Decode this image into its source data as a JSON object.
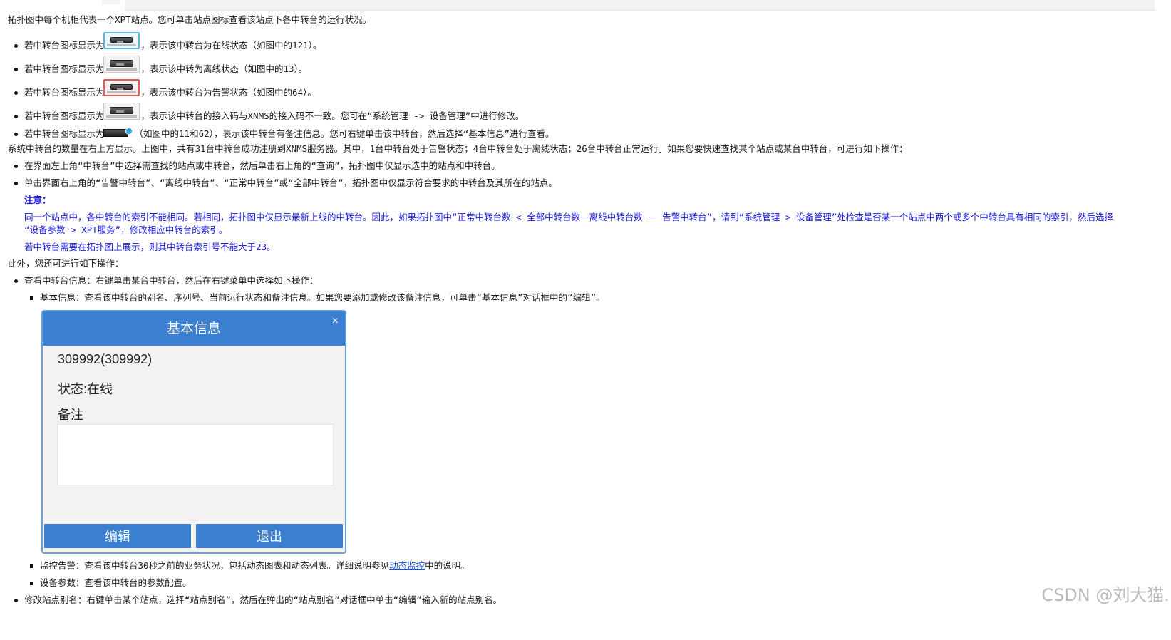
{
  "intro": "拓扑图中每个机柜代表一个XPT站点。您可单击站点图标查看该站点下各中转台的运行状况。",
  "status_items": [
    {
      "prefix": "若中转台图标显示为",
      "suffix": "，表示该中转台为在线状态（如图中的121）。",
      "icon": "relay-online-icon",
      "frame": "#5ab4de"
    },
    {
      "prefix": "若中转台图标显示为",
      "suffix": "，表示该中转为离线状态（如图中的13）。",
      "icon": "relay-offline-icon",
      "frame": "#c8c8c8"
    },
    {
      "prefix": "若中转台图标显示为",
      "suffix": "，表示该中转台为告警状态（如图中的64）。",
      "icon": "relay-alarm-icon",
      "frame": "#e05a5a"
    },
    {
      "prefix": "若中转台图标显示为",
      "suffix": "，表示该中转台的接入码与XNMS的接入码不一致。您可在“系统管理 -> 设备管理”中进行修改。",
      "icon": "relay-mismatch-icon",
      "frame": "#c8c8c8"
    },
    {
      "prefix": "若中转台图标显示为",
      "suffix": "（如图中的11和62），表示该中转台有备注信息。您可右键单击该中转台，然后选择“基本信息”进行查看。",
      "icon": "relay-note-icon",
      "frame": "none"
    }
  ],
  "summary": "系统中转台的数量在右上方显示。上图中，共有31台中转台成功注册到XNMS服务器。其中，1台中转台处于告警状态；4台中转台处于离线状态；26台中转台正常运行。如果您要快速查找某个站点或某台中转台，可进行如下操作：",
  "search_items": [
    "在界面左上角“中转台”中选择需查找的站点或中转台，然后单击右上角的“查询”，拓扑图中仅显示选中的站点和中转台。",
    "单击界面右上角的“告警中转台”、“离线中转台”、“正常中转台”或“全部中转台”，拓扑图中仅显示符合要求的中转台及其所在的站点。"
  ],
  "note": {
    "title": "注意：",
    "p1_line1": "同一个站点中，各中转台的索引不能相同。若相同，拓扑图中仅显示最新上线的中转台。因此，如果拓扑图中“正常中转台数 < 全部中转台数－离线中转台数 － 告警中转台”，请到“系统管理 > 设备管理”处检查是否某一个站点中两个或多个中转台具有相同的索引，然后选择",
    "p1_line2": "“设备参数 > XPT服务”，修改相应中转台的索引。",
    "p2": "若中转台需要在拓扑图上展示，则其中转台索引号不能大于23。"
  },
  "more": "此外，您还可进行如下操作：",
  "op_view": "查看中转台信息：右键单击某台中转台，然后在右键菜单中选择如下操作：",
  "sub_basic": "基本信息：查看该中转台的别名、序列号、当前运行状态和备注信息。如果您要添加或修改该备注信息，可单击“基本信息”对话框中的“编辑”。",
  "dialog": {
    "title": "基本信息",
    "close": "×",
    "id": "309992(309992)",
    "status": "状态:在线",
    "note_label": "备注",
    "note_value": "",
    "edit_button": "编辑",
    "exit_button": "退出"
  },
  "sub_monitor_pre": "监控告警：查看该中转台30秒之前的业务状况，包括动态图表和动态列表。详细说明参见",
  "sub_monitor_link": "动态监控",
  "sub_monitor_post": "中的说明。",
  "sub_params": "设备参数：查看该中转台的参数配置。",
  "op_rename": "修改站点别名：右键单击某个站点，选择“站点别名”，然后在弹出的“站点别名”对话框中单击“编辑”输入新的站点别名。",
  "watermark": "CSDN @刘大猫."
}
